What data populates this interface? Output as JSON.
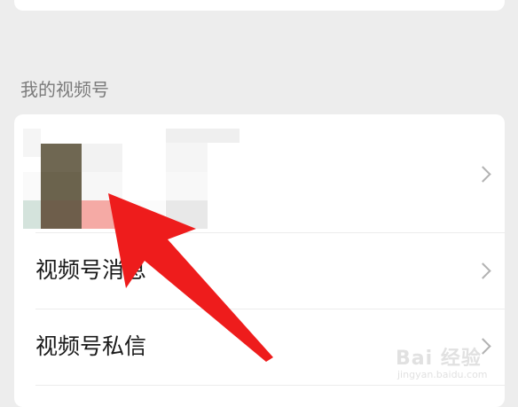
{
  "section": {
    "title": "我的视频号"
  },
  "menu": {
    "items": [
      {
        "label": "视频号消息"
      },
      {
        "label": "视频号私信"
      }
    ]
  },
  "profile": {
    "avatar_colors": [
      "#6b5e4a",
      "#f5a9a4",
      "#d4e3dc",
      "#e8e8e8"
    ]
  },
  "annotation": {
    "arrow_color": "#ee1c1c"
  },
  "watermark": {
    "text": "Bai 经验",
    "sub": "jingyan.baidu.com"
  }
}
